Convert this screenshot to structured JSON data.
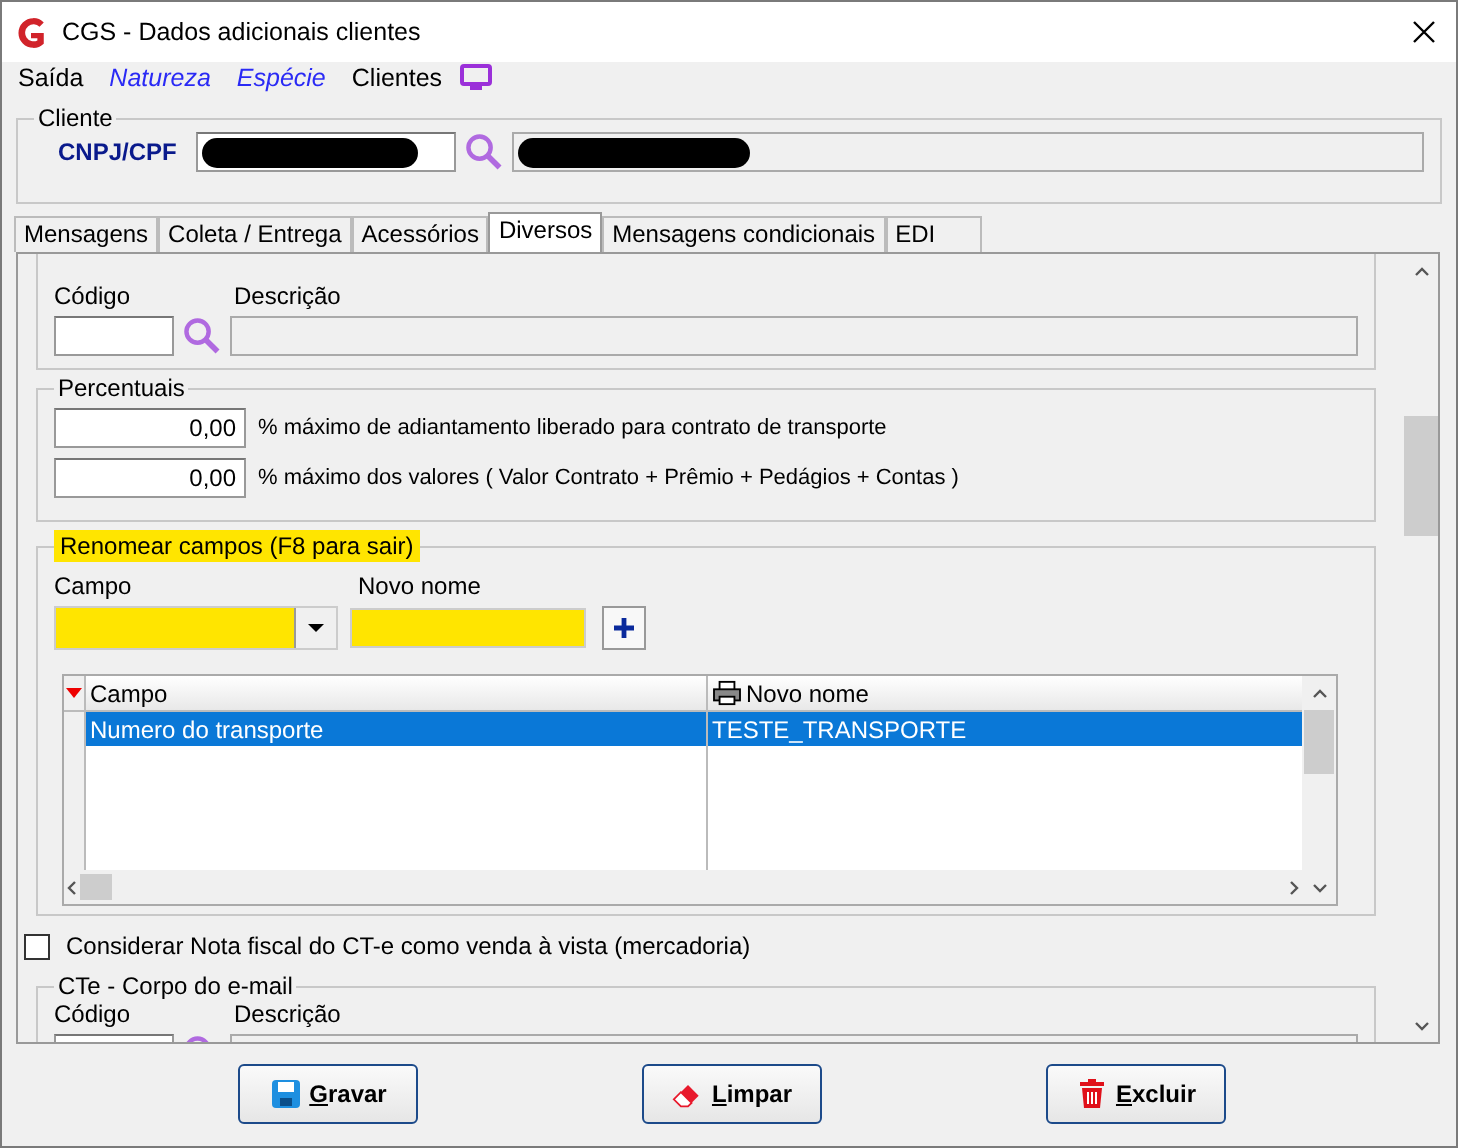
{
  "window": {
    "title": "CGS - Dados adicionais clientes"
  },
  "menu": [
    {
      "label": "Saída",
      "kind": "plain"
    },
    {
      "label": "Natureza",
      "kind": "link"
    },
    {
      "label": "Espécie",
      "kind": "link"
    },
    {
      "label": "Clientes",
      "kind": "plain"
    }
  ],
  "cliente": {
    "title": "Cliente",
    "label": "CNPJ/CPF"
  },
  "tabs": [
    {
      "label": "Mensagens",
      "selected": false
    },
    {
      "label": "Coleta / Entrega",
      "selected": false
    },
    {
      "label": "Acessórios",
      "selected": false
    },
    {
      "label": "Diversos",
      "selected": true
    },
    {
      "label": "Mensagens condicionais",
      "selected": false
    },
    {
      "label": "EDI",
      "selected": false
    }
  ],
  "seguro": {
    "codigo_label": "Código",
    "descricao_label": "Descrição"
  },
  "percentuais": {
    "title": "Percentuais",
    "rows": [
      {
        "value": "0,00",
        "label": "% máximo de adiantamento liberado para contrato de transporte"
      },
      {
        "value": "0,00",
        "label": "% máximo dos valores ( Valor Contrato + Prêmio + Pedágios + Contas )"
      }
    ]
  },
  "renomear": {
    "title": "Renomear campos (F8 para sair)",
    "campo_label": "Campo",
    "novo_nome_label": "Novo nome",
    "table": {
      "columns": [
        "Campo",
        "Novo nome"
      ],
      "rows": [
        {
          "cells": [
            "Numero do transporte",
            "TESTE_TRANSPORTE"
          ],
          "selected": true
        }
      ]
    }
  },
  "checkbox": {
    "label": "Considerar Nota fiscal do CT-e como venda à vista (mercadoria)",
    "checked": false
  },
  "cte": {
    "title": "CTe - Corpo do e-mail",
    "codigo_label": "Código",
    "descricao_label": "Descrição"
  },
  "buttons": [
    {
      "label": "Gravar",
      "kind": "save"
    },
    {
      "label": "Limpar",
      "kind": "clear"
    },
    {
      "label": "Excluir",
      "kind": "delete"
    }
  ]
}
